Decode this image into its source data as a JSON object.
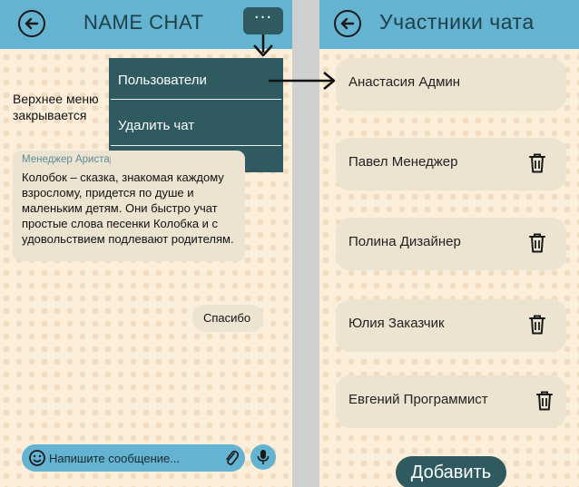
{
  "left_screen": {
    "header": {
      "title": "NAME CHAT",
      "menu_label": "···"
    },
    "dropdown": {
      "items": [
        "Пользователи",
        "Удалить чат"
      ]
    },
    "annotation": "Верхнее меню закрывается",
    "messages": [
      {
        "sender": "Менеджер Аристарх",
        "text": "Колобок – сказка, знакомая каждому взрослому, придется по душе и маленьким детям. Они быстро учат простые слова песенки Колобка и с удовольствием подлевают родителям."
      },
      {
        "text": "Спасибо"
      }
    ],
    "composer": {
      "placeholder": "Напишите сообщение..."
    }
  },
  "right_screen": {
    "header": {
      "title": "Участники чата"
    },
    "members": [
      {
        "name": "Анастасия Админ",
        "removable": false
      },
      {
        "name": "Павел Менеджер",
        "removable": true
      },
      {
        "name": "Полина Дизайнер",
        "removable": true
      },
      {
        "name": "Юлия Заказчик",
        "removable": true
      },
      {
        "name": "Евгений Программист",
        "removable": true
      }
    ],
    "add_button": "Добавить"
  },
  "colors": {
    "header": "#63b3d1",
    "dark_accent": "#2e5a60",
    "bubble": "#ece3d1",
    "background": "#fbeedb"
  },
  "icons": [
    "back-arrow-icon",
    "menu-dots-icon",
    "smile-icon",
    "paperclip-icon",
    "microphone-icon",
    "trash-icon"
  ]
}
